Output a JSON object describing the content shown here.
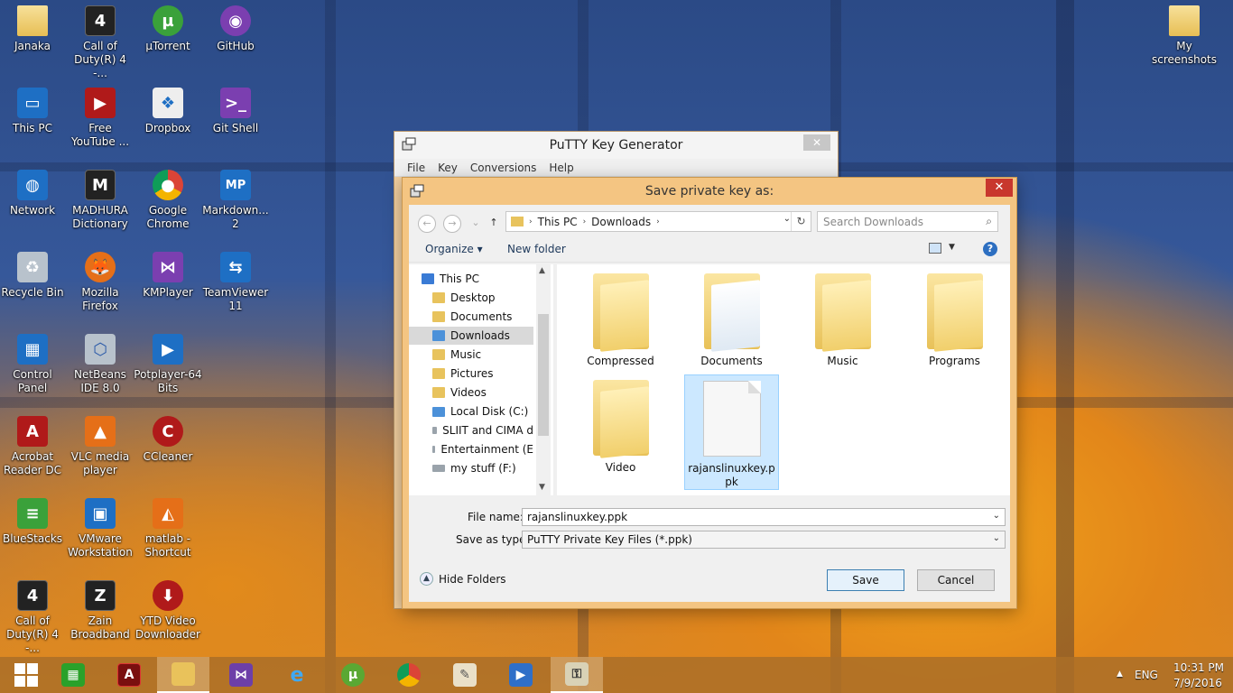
{
  "desktop": {
    "icons": [
      {
        "label": "Janaka",
        "glyph": "👤"
      },
      {
        "label": "Call of Duty(R) 4 -...",
        "glyph": "4"
      },
      {
        "label": "µTorrent",
        "glyph": "µ"
      },
      {
        "label": "GitHub",
        "glyph": "◉"
      },
      {
        "label": "This PC",
        "glyph": "▭"
      },
      {
        "label": "Free YouTube ...",
        "glyph": "▶"
      },
      {
        "label": "Dropbox",
        "glyph": "❖"
      },
      {
        "label": "Git Shell",
        "glyph": ">_"
      },
      {
        "label": "Network",
        "glyph": "◍"
      },
      {
        "label": "MADHURA Dictionary",
        "glyph": "M"
      },
      {
        "label": "Google Chrome",
        "glyph": "●"
      },
      {
        "label": "Markdown... 2",
        "glyph": "MP"
      },
      {
        "label": "Recycle Bin",
        "glyph": "♻"
      },
      {
        "label": "Mozilla Firefox",
        "glyph": "🦊"
      },
      {
        "label": "KMPlayer",
        "glyph": "⋈"
      },
      {
        "label": "TeamViewer 11",
        "glyph": "⇆"
      },
      {
        "label": "Control Panel",
        "glyph": "▦"
      },
      {
        "label": "NetBeans IDE 8.0",
        "glyph": "⬡"
      },
      {
        "label": "Potplayer-64 Bits",
        "glyph": "▶"
      },
      {
        "label": "Acrobat Reader DC",
        "glyph": "A"
      },
      {
        "label": "VLC media player",
        "glyph": "▲"
      },
      {
        "label": "CCleaner",
        "glyph": "C"
      },
      {
        "label": "BlueStacks",
        "glyph": "≡"
      },
      {
        "label": "VMware Workstation",
        "glyph": "▣"
      },
      {
        "label": "matlab - Shortcut",
        "glyph": "◭"
      },
      {
        "label": "Call of Duty(R) 4 -...",
        "glyph": "4"
      },
      {
        "label": "Zain Broadband",
        "glyph": "Z"
      },
      {
        "label": "YTD Video Downloader",
        "glyph": "⬇"
      },
      {
        "label": "My screenshots",
        "glyph": ""
      }
    ]
  },
  "putty": {
    "title": "PuTTY Key Generator",
    "close": "✕",
    "menu": [
      "File",
      "Key",
      "Conversions",
      "Help"
    ]
  },
  "dialog": {
    "title": "Save private key as:",
    "close": "✕",
    "nav": {
      "back": "←",
      "forward": "→",
      "recent": "⌄",
      "up": "↑"
    },
    "address": [
      "This PC",
      "Downloads"
    ],
    "refresh": "↻",
    "search_placeholder": "Search Downloads",
    "toolbar": {
      "organize": "Organize ▾",
      "new_folder": "New folder",
      "help": "?"
    },
    "nav_pane": [
      {
        "label": "This PC",
        "icon": "pc"
      },
      {
        "label": "Desktop",
        "icon": "folder"
      },
      {
        "label": "Documents",
        "icon": "folder"
      },
      {
        "label": "Downloads",
        "icon": "dl",
        "selected": true
      },
      {
        "label": "Music",
        "icon": "folder"
      },
      {
        "label": "Pictures",
        "icon": "folder"
      },
      {
        "label": "Videos",
        "icon": "folder"
      },
      {
        "label": "Local Disk (C:)",
        "icon": "drive"
      },
      {
        "label": "SLIIT and CIMA d",
        "icon": "drive"
      },
      {
        "label": "Entertainment (E",
        "icon": "drive"
      },
      {
        "label": "my stuff (F:)",
        "icon": "drive"
      }
    ],
    "files": [
      {
        "label": "Compressed",
        "kind": "folder"
      },
      {
        "label": "Documents",
        "kind": "folder"
      },
      {
        "label": "Music",
        "kind": "folder"
      },
      {
        "label": "Programs",
        "kind": "folder"
      },
      {
        "label": "Video",
        "kind": "folder"
      },
      {
        "label": "rajanslinuxkey.ppk",
        "kind": "file",
        "selected": true
      }
    ],
    "file_name_label": "File name:",
    "file_name_value": "rajanslinuxkey.ppk",
    "save_type_label": "Save as type:",
    "save_type_value": "PuTTY Private Key Files (*.ppk)",
    "hide_folders": "Hide Folders",
    "save": "Save",
    "cancel": "Cancel"
  },
  "taskbar": {
    "apps": [
      "start",
      "store",
      "acrobat",
      "explorer",
      "kmplayer",
      "ie",
      "utorrent",
      "chrome",
      "paint",
      "potplayer",
      "puttygen"
    ],
    "tray_arrow": "▲",
    "lang": "ENG",
    "time": "10:31 PM",
    "date": "7/9/2016"
  }
}
